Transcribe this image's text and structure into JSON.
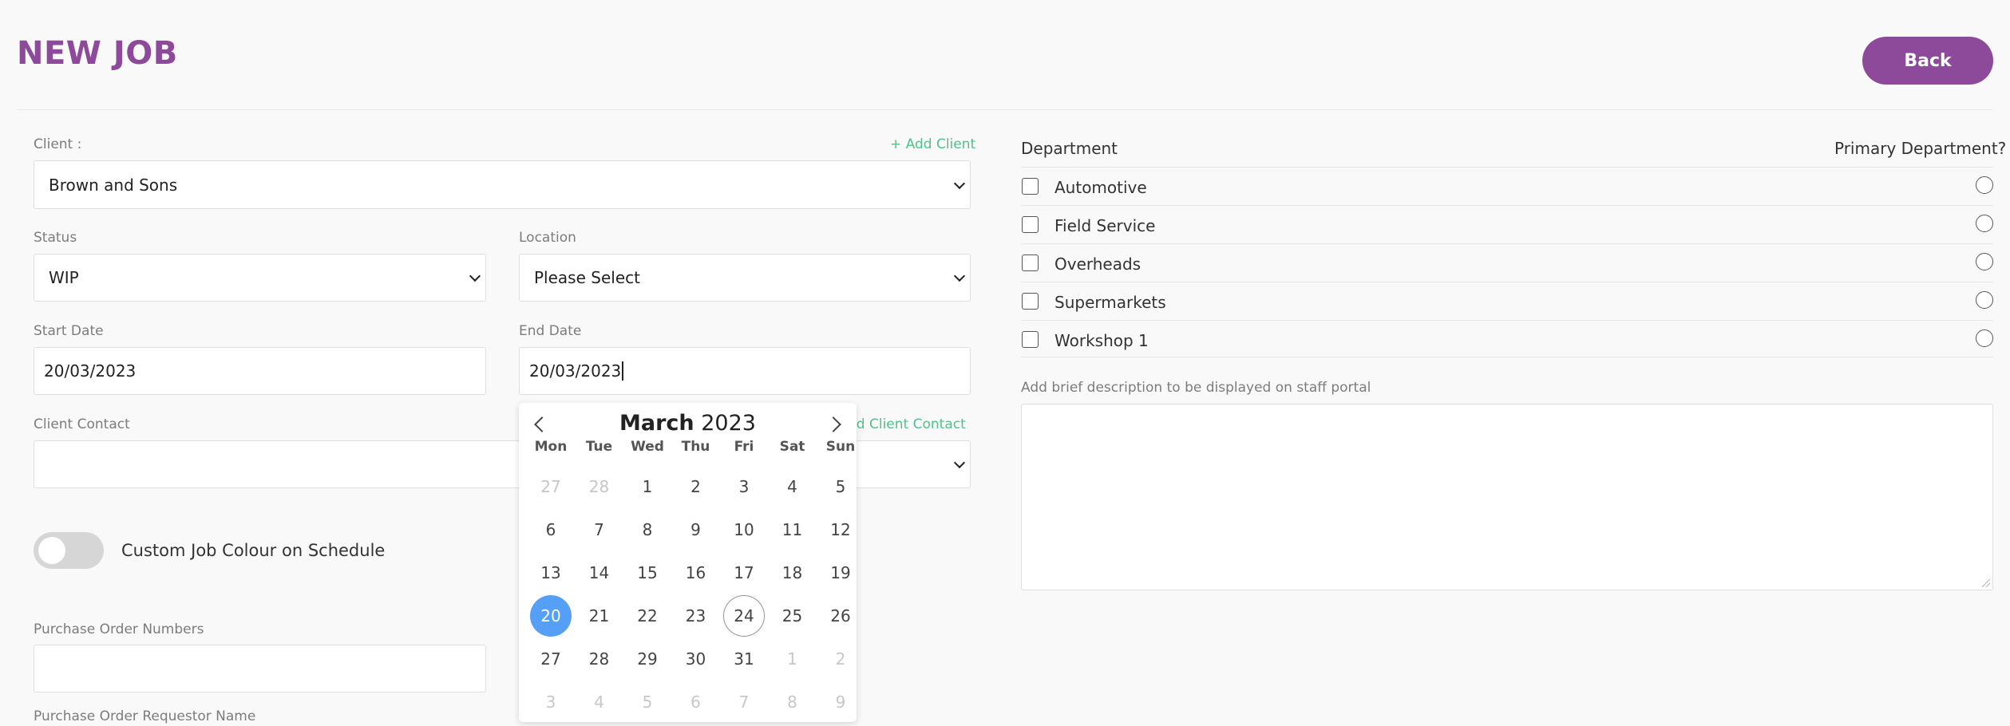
{
  "header": {
    "title": "NEW JOB",
    "back_label": "Back"
  },
  "client": {
    "label": "Client :",
    "add_link": "+ Add Client",
    "value": "Brown and Sons"
  },
  "status": {
    "label": "Status",
    "value": "WIP"
  },
  "location": {
    "label": "Location",
    "value": "Please Select"
  },
  "start_date": {
    "label": "Start Date",
    "value": "20/03/2023"
  },
  "end_date": {
    "label": "End Date",
    "value": "20/03/2023"
  },
  "client_contact": {
    "label": "Client Contact",
    "add_link": "dd Client Contact",
    "value": ""
  },
  "custom_colour": {
    "label": "Custom Job Colour on Schedule",
    "enabled": false
  },
  "purchase_order": {
    "label": "Purchase Order Numbers",
    "value": ""
  },
  "po_requestor": {
    "label": "Purchase Order Requestor Name",
    "value": ""
  },
  "calendar": {
    "month": "March",
    "year": "2023",
    "weekdays": [
      "Mon",
      "Tue",
      "Wed",
      "Thu",
      "Fri",
      "Sat",
      "Sun"
    ],
    "weeks": [
      [
        [
          "27",
          true
        ],
        [
          "28",
          true
        ],
        [
          "1",
          false
        ],
        [
          "2",
          false
        ],
        [
          "3",
          false
        ],
        [
          "4",
          false
        ],
        [
          "5",
          false
        ]
      ],
      [
        [
          "6",
          false
        ],
        [
          "7",
          false
        ],
        [
          "8",
          false
        ],
        [
          "9",
          false
        ],
        [
          "10",
          false
        ],
        [
          "11",
          false
        ],
        [
          "12",
          false
        ]
      ],
      [
        [
          "13",
          false
        ],
        [
          "14",
          false
        ],
        [
          "15",
          false
        ],
        [
          "16",
          false
        ],
        [
          "17",
          false
        ],
        [
          "18",
          false
        ],
        [
          "19",
          false
        ]
      ],
      [
        [
          "20",
          false
        ],
        [
          "21",
          false
        ],
        [
          "22",
          false
        ],
        [
          "23",
          false
        ],
        [
          "24",
          false
        ],
        [
          "25",
          false
        ],
        [
          "26",
          false
        ]
      ],
      [
        [
          "27",
          false
        ],
        [
          "28",
          false
        ],
        [
          "29",
          false
        ],
        [
          "30",
          false
        ],
        [
          "31",
          false
        ],
        [
          "1",
          true
        ],
        [
          "2",
          true
        ]
      ],
      [
        [
          "3",
          true
        ],
        [
          "4",
          true
        ],
        [
          "5",
          true
        ],
        [
          "6",
          true
        ],
        [
          "7",
          true
        ],
        [
          "8",
          true
        ],
        [
          "9",
          true
        ]
      ]
    ],
    "selected": "20",
    "today": "24"
  },
  "departments": {
    "header": "Department",
    "primary_header": "Primary Department?",
    "items": [
      "Automotive",
      "Field Service",
      "Overheads",
      "Supermarkets",
      "Workshop 1"
    ]
  },
  "description": {
    "label": "Add brief description to be displayed on staff portal",
    "value": ""
  },
  "colors": {
    "brand": "#8d4a9a",
    "accent_link": "#4fc38a",
    "selected_day": "#569ff7"
  }
}
